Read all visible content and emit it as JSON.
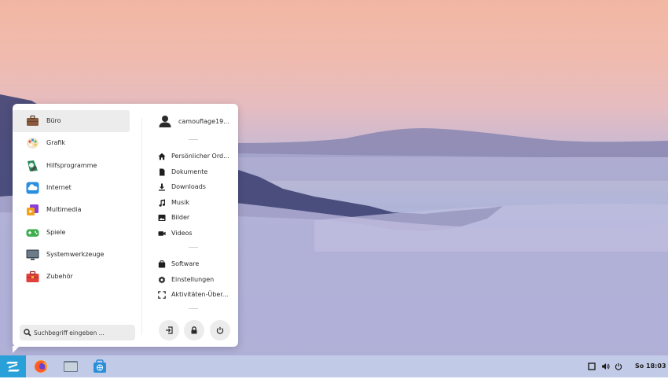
{
  "menu": {
    "categories": [
      {
        "label": "Büro",
        "icon": "briefcase-icon",
        "active": true
      },
      {
        "label": "Grafik",
        "icon": "palette-icon"
      },
      {
        "label": "Hilfsprogramme",
        "icon": "utilities-icon"
      },
      {
        "label": "Internet",
        "icon": "cloud-icon"
      },
      {
        "label": "Multimedia",
        "icon": "multimedia-icon"
      },
      {
        "label": "Spiele",
        "icon": "gamepad-icon"
      },
      {
        "label": "Systemwerkzeuge",
        "icon": "monitor-icon"
      },
      {
        "label": "Zubehör",
        "icon": "toolbox-icon"
      }
    ],
    "user": {
      "name": "camouflage19...",
      "icon": "user-icon"
    },
    "places": [
      {
        "label": "Persönlicher Ord...",
        "icon": "home-icon"
      },
      {
        "label": "Dokumente",
        "icon": "document-icon"
      },
      {
        "label": "Downloads",
        "icon": "download-icon"
      },
      {
        "label": "Musik",
        "icon": "music-icon"
      },
      {
        "label": "Bilder",
        "icon": "image-icon"
      },
      {
        "label": "Videos",
        "icon": "video-icon"
      }
    ],
    "system": [
      {
        "label": "Software",
        "icon": "software-icon"
      },
      {
        "label": "Einstellungen",
        "icon": "settings-icon"
      },
      {
        "label": "Aktivitäten-Über...",
        "icon": "activities-icon"
      }
    ],
    "search": {
      "placeholder": "Suchbegriff eingeben ..."
    },
    "buttons": {
      "logout": "logout-icon",
      "lock": "lock-icon",
      "power": "power-icon"
    }
  },
  "taskbar": {
    "start": "zorin-logo-icon",
    "apps": [
      "firefox-icon",
      "files-icon",
      "software-store-icon"
    ],
    "tray": [
      "window-icon",
      "volume-icon",
      "power-icon"
    ],
    "clock": "So 18:03"
  },
  "colors": {
    "accent": "#2aa0d8",
    "taskbar": "#c1cbe8",
    "menu_bg": "#ffffff",
    "active_item": "#ececec"
  }
}
